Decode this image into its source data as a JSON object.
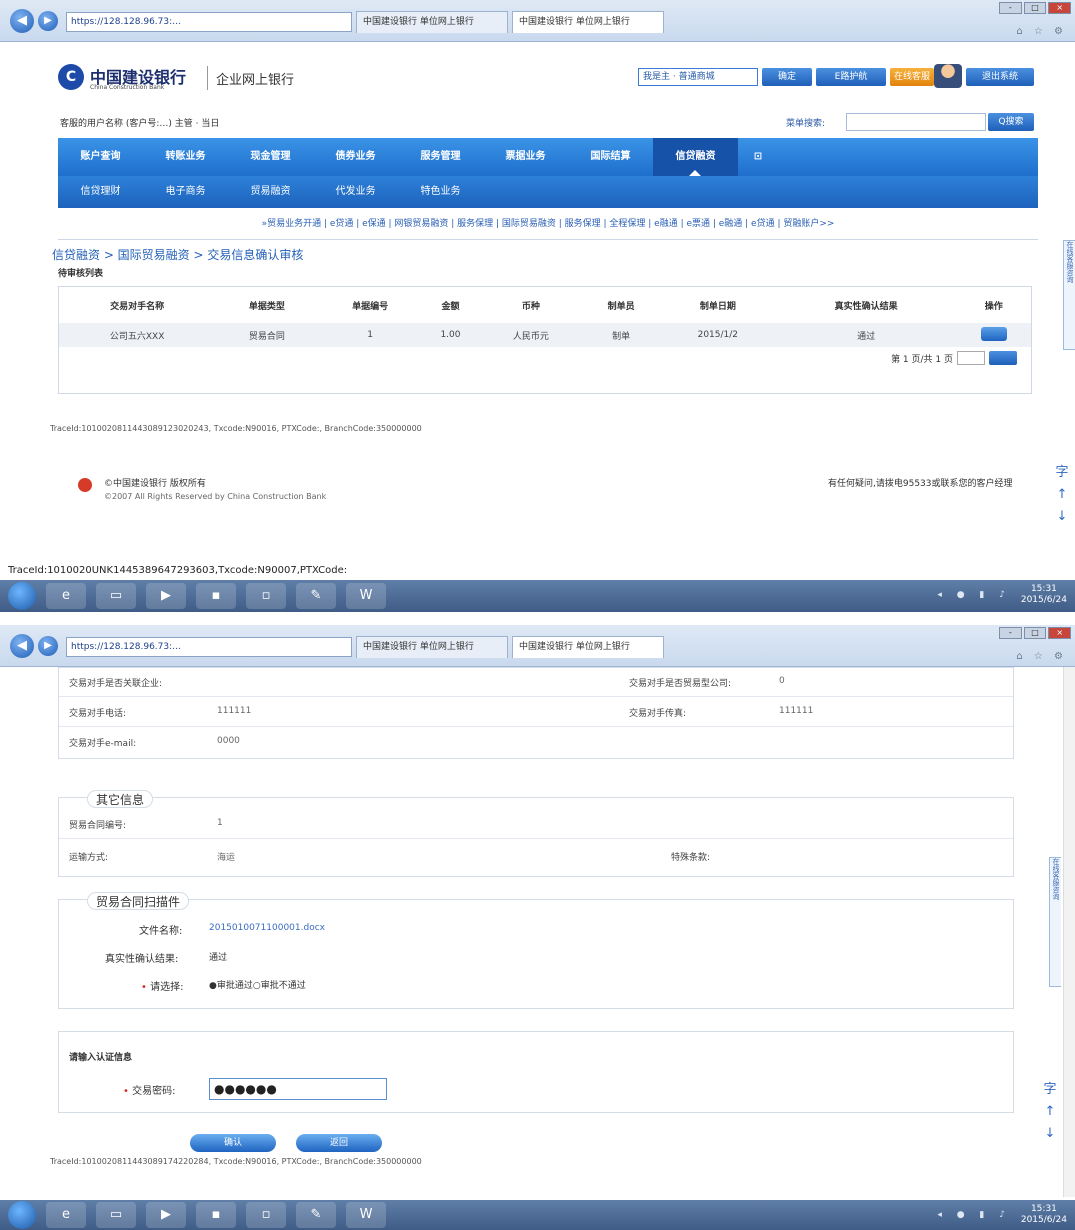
{
  "browser": {
    "address": "https://128.128.96.73:…",
    "tabs": [
      "中国建设银行 单位网上银行",
      "中国建设银行 单位网上银行"
    ],
    "window_controls": [
      "-",
      "□",
      "×"
    ]
  },
  "bank": {
    "logo_char": "C",
    "name_cn": "中国建设银行",
    "name_en": "China Construction Bank",
    "product": "企业网上银行",
    "select_text": "我是主 · 普通商城",
    "btns": [
      "确定",
      "E路护航",
      "在线客服",
      "退出系统"
    ]
  },
  "user_line": "客服的用户名称 (客户号:…) 主管 · 当日",
  "search": {
    "label": "菜单搜索:",
    "button": "Q搜索"
  },
  "nav1": [
    "账户查询",
    "转账业务",
    "现金管理",
    "债券业务",
    "服务管理",
    "票据业务",
    "国际结算",
    "信贷融资",
    "⊡"
  ],
  "nav2": [
    "信贷理财",
    "电子商务",
    "贸易融资",
    "代发业务",
    "特色业务"
  ],
  "nav3": "»贸易业务开通 | e贷通 | e保通 | 网银贸易融资 | 服务保理 | 国际贸易融资 | 服务保理 | 全程保理 | e融通 | e票通 | e融通 | e贷通 | 贸融账户>>",
  "breadcrumb": "信贷融资 > 国际贸易融资 > 交易信息确认审核",
  "list_title": "待审核列表",
  "table": {
    "headers": [
      "交易对手名称",
      "单据类型",
      "单据编号",
      "金额",
      "币种",
      "制单员",
      "制单日期",
      "真实性确认结果",
      "操作"
    ],
    "rows": [
      [
        "公司五六XXX",
        "贸易合同",
        "1",
        "1.00",
        "人民币元",
        "制单",
        "2015/1/2",
        "通过",
        ""
      ]
    ]
  },
  "pager": "第 1 页/共 1 页",
  "trace1": "TraceId:1010020811443089123020243, Txcode:N90016, PTXCode:, BranchCode:350000000",
  "footer": {
    "title": "©中国建设银行 版权所有",
    "copyright": "©2007 All Rights Reserved by China Construction Bank",
    "right": "有任何疑问,请拨电95533或联系您的客户经理"
  },
  "side_tab": "在线客服咨询",
  "right_tools": [
    "字",
    "↑",
    "↓"
  ],
  "status_trace": "TraceId:1010020UNK1445389647293603,Txcode:N90007,PTXCode:",
  "taskbar": {
    "time": "15:31",
    "date": "2015/6/24"
  },
  "screen2": {
    "counterpart": [
      {
        "label": "交易对手是否关联企业:",
        "value": ""
      },
      {
        "label": "交易对手是否贸易型公司:",
        "value": "0"
      },
      {
        "label": "交易对手电话:",
        "value": "111111"
      },
      {
        "label": "交易对手传真:",
        "value": "111111"
      },
      {
        "label": "交易对手e-mail:",
        "value": "0000"
      }
    ],
    "other_title": "其它信息",
    "other": [
      {
        "label": "贸易合同编号:",
        "value": "1"
      },
      {
        "label": "运输方式:",
        "value": "海运"
      },
      {
        "label": "特殊条款:",
        "value": ""
      }
    ],
    "contract_title": "贸易合同扫描件",
    "file_label": "文件名称:",
    "file_name": "2015010071100001.docx",
    "auth_label": "真实性确认结果:",
    "auth_value": "通过",
    "choose_label": "请选择:",
    "choose_value": "●审批通过○审批不通过",
    "cred_title": "请输入认证信息",
    "pw_label": "交易密码:",
    "pw_value": "●●●●●●",
    "confirm": "确认",
    "back": "返回",
    "trace2": "TraceId:1010020811443089174220284, Txcode:N90016, PTXCode:, BranchCode:350000000"
  }
}
